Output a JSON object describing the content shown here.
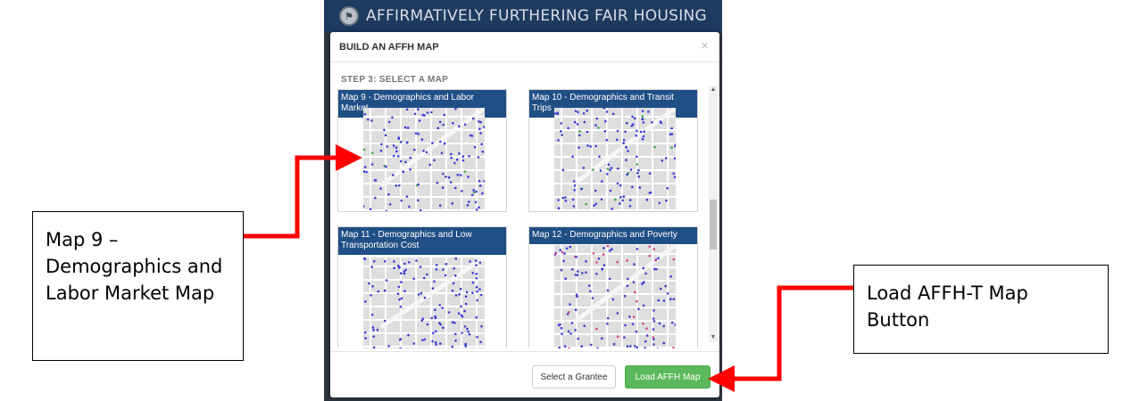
{
  "app": {
    "title": "AFFIRMATIVELY FURTHERING FAIR HOUSING",
    "seal_glyph": "⚑"
  },
  "modal": {
    "title": "BUILD AN AFFH MAP",
    "close_label": "×",
    "step_label": "STEP 3: SELECT A MAP",
    "maps": [
      {
        "title": "Map 9 - Demographics and Labor Market"
      },
      {
        "title": "Map 10 - Demographics and Transit Trips"
      },
      {
        "title": "Map 11 - Demographics and Low Transportation Cost"
      },
      {
        "title": "Map 12 - Demographics and Poverty"
      }
    ],
    "scroll_up_glyph": "▲",
    "scroll_down_glyph": "▼",
    "footer": {
      "select_grantee_label": "Select a Grantee",
      "load_map_label": "Load AFFH Map"
    }
  },
  "callouts": {
    "left_text": "Map 9 – Demographics and Labor Market Map",
    "right_text": "Load AFFH-T Map Button"
  },
  "colors": {
    "header_bg": "#1f3a5f",
    "card_title_bg": "#204f85",
    "success": "#5cb85c",
    "arrow": "#ff0000",
    "dot_blue": "#3b3bd6",
    "dot_green": "#3aa84a",
    "dot_pink": "#e0408a"
  }
}
